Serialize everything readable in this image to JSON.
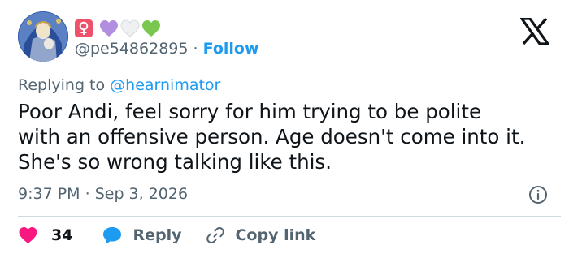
{
  "author": {
    "handle": "@pe54862895",
    "follow_label": "Follow",
    "separator": "·",
    "badges": [
      "venus-icon",
      "purple-heart-icon",
      "white-heart-icon",
      "green-heart-icon"
    ]
  },
  "replying": {
    "prefix": "Replying to ",
    "to": "@hearnimator"
  },
  "tweet": {
    "lines": [
      "Poor Andi, feel sorry for him trying to be polite",
      "with an offensive person. Age doesn't come into it.",
      "She's so wrong talking like this."
    ]
  },
  "meta": {
    "time": "9:37 PM",
    "separator": "·",
    "date": "Sep 3, 2026"
  },
  "actions": {
    "like_count": "34",
    "reply_label": "Reply",
    "copy_label": "Copy link"
  },
  "colors": {
    "accent": "#1d9bf0",
    "like": "#f91880",
    "text": "#0f1419",
    "muted": "#536471",
    "purple_heart": "#b28ee0",
    "green_heart": "#7ac74f",
    "venus_bg": "#f0516a"
  }
}
